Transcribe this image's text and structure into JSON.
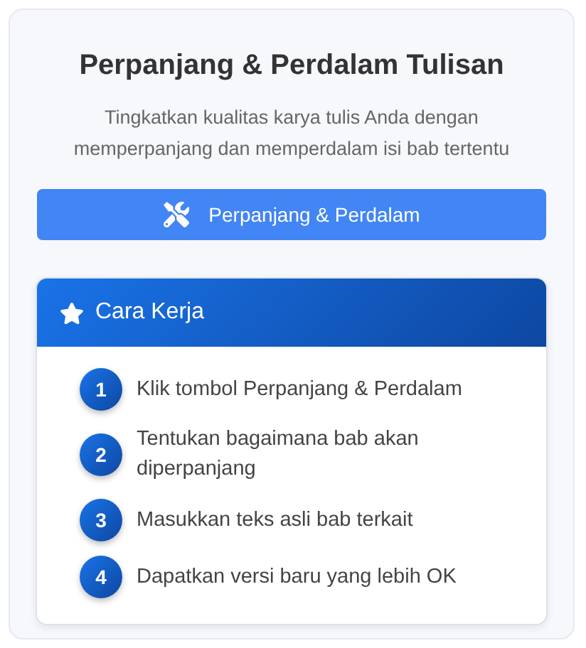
{
  "title": "Perpanjang & Perdalam Tulisan",
  "subtitle": "Tingkatkan kualitas karya tulis Anda dengan memperpanjang dan memperdalam isi bab tertentu",
  "action_button": {
    "label": "Perpanjang & Perdalam"
  },
  "how_it_works": {
    "title": "Cara Kerja",
    "steps": [
      {
        "number": "1",
        "text": "Klik tombol Perpanjang & Perdalam"
      },
      {
        "number": "2",
        "text": "Tentukan bagaimana bab akan diperpanjang"
      },
      {
        "number": "3",
        "text": "Masukkan teks asli bab terkait"
      },
      {
        "number": "4",
        "text": "Dapatkan versi baru yang lebih OK"
      }
    ]
  }
}
